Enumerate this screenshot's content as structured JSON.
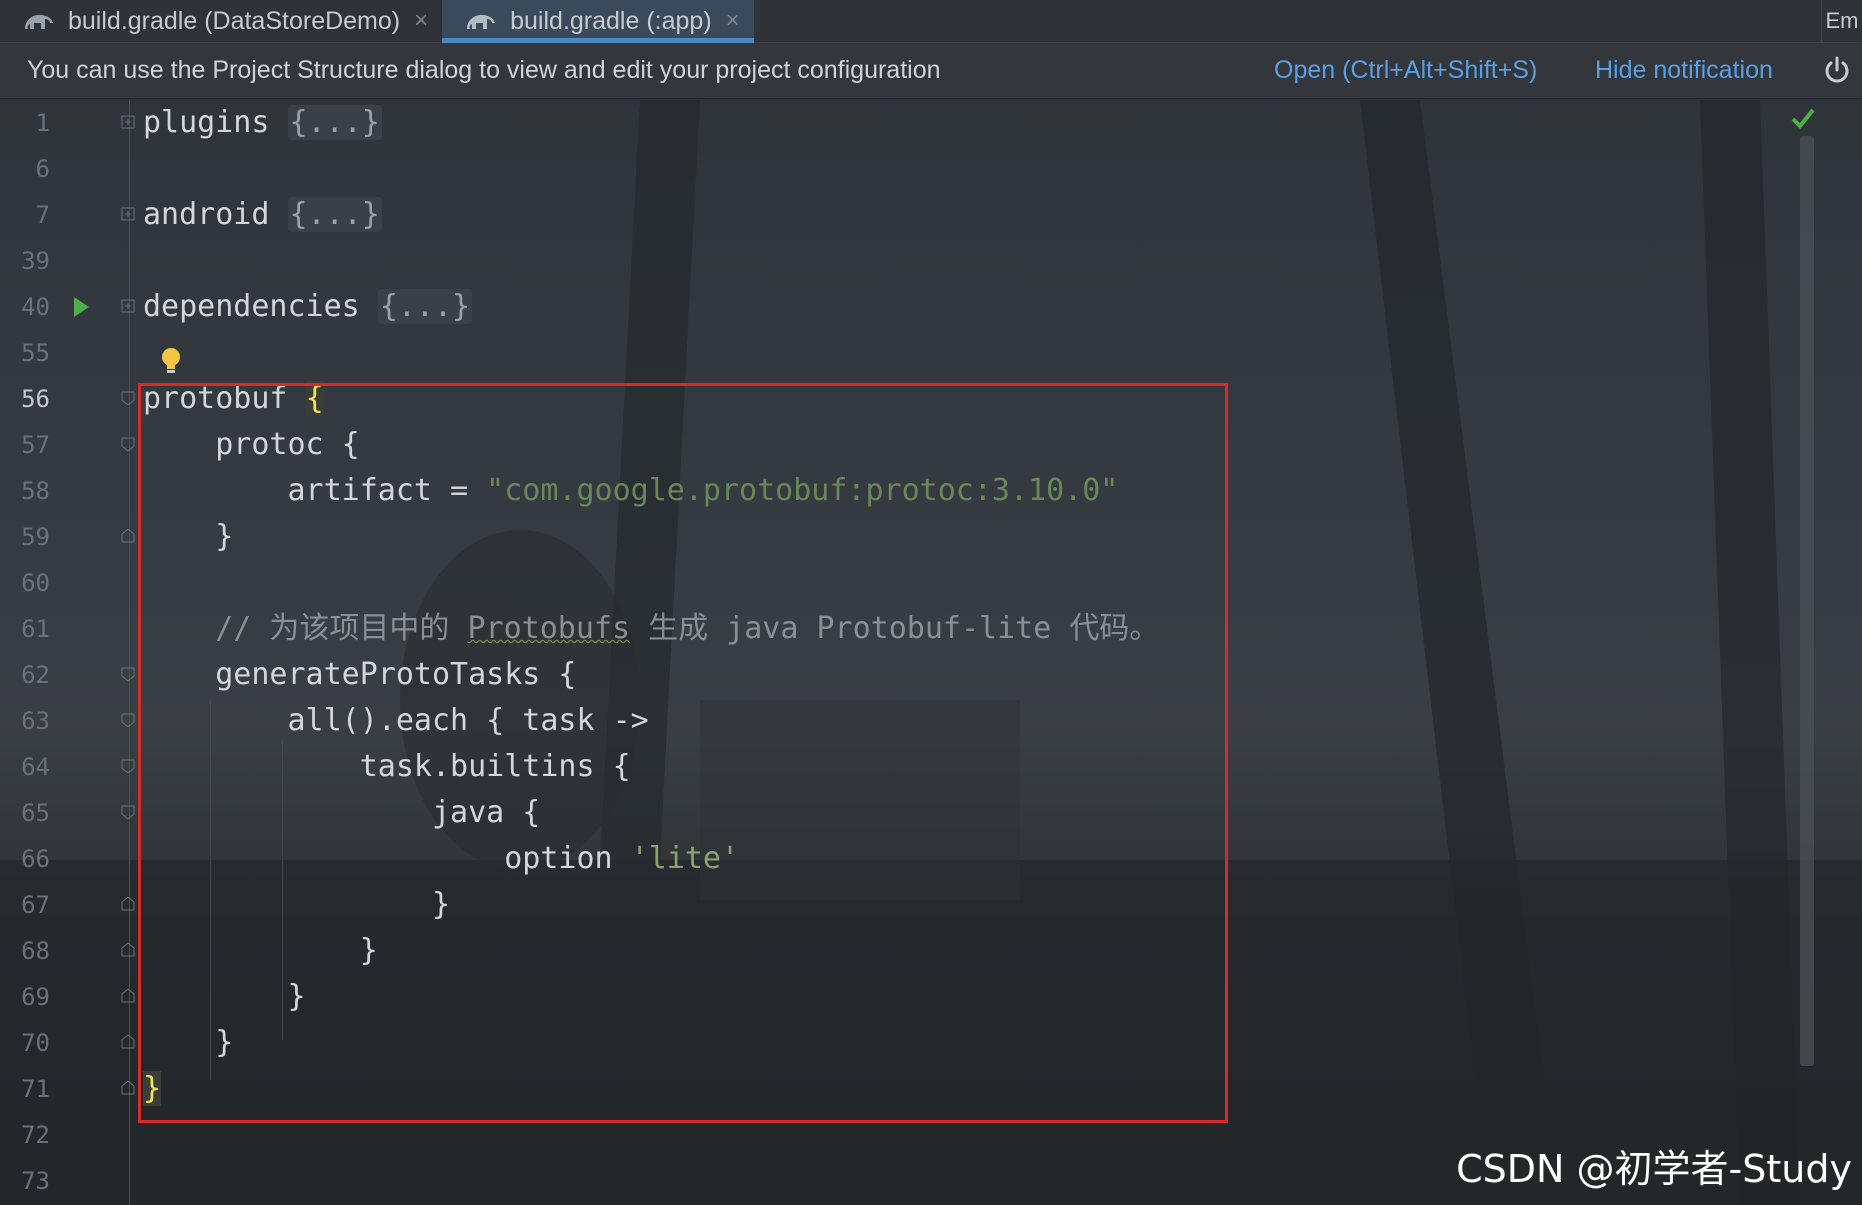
{
  "tabs": [
    {
      "label": "build.gradle (DataStoreDemo)",
      "active": false
    },
    {
      "label": "build.gradle (:app)",
      "active": true
    }
  ],
  "tab_overflow_label": "Em",
  "notification": {
    "message": "You can use the Project Structure dialog to view and edit your project configuration",
    "open_link": "Open (Ctrl+Alt+Shift+S)",
    "hide_link": "Hide notification"
  },
  "editor": {
    "current_line": "56",
    "lines": [
      {
        "n": "1",
        "code": "plugins",
        "folded": "{...}"
      },
      {
        "n": "6",
        "code": ""
      },
      {
        "n": "7",
        "code": "android",
        "folded": "{...}"
      },
      {
        "n": "39",
        "code": ""
      },
      {
        "n": "40",
        "code": "dependencies",
        "folded": "{...}"
      },
      {
        "n": "55",
        "code": ""
      },
      {
        "n": "56",
        "code": "protobuf ",
        "brace": "{"
      },
      {
        "n": "57",
        "code": "    protoc {"
      },
      {
        "n": "58",
        "code": "        artifact = ",
        "string": "\"com.google.protobuf:protoc:3.10.0\""
      },
      {
        "n": "59",
        "code": "    }"
      },
      {
        "n": "60",
        "code": ""
      },
      {
        "n": "61",
        "comment_pre": "    // 为该项目中的 ",
        "comment_squiggle": "Protobufs",
        "comment_post": " 生成 java Protobuf-lite 代码。"
      },
      {
        "n": "62",
        "code": "    generateProtoTasks {"
      },
      {
        "n": "63",
        "code": "        all().each { task ->"
      },
      {
        "n": "64",
        "code": "            task.builtins {"
      },
      {
        "n": "65",
        "code": "                java {"
      },
      {
        "n": "66",
        "code": "                    option ",
        "string2": "'lite'"
      },
      {
        "n": "67",
        "code": "                }"
      },
      {
        "n": "68",
        "code": "            }"
      },
      {
        "n": "69",
        "code": "        }"
      },
      {
        "n": "70",
        "code": "    }"
      },
      {
        "n": "71",
        "brace_close": "}"
      },
      {
        "n": "72",
        "code": ""
      },
      {
        "n": "73",
        "code": ""
      }
    ]
  },
  "watermark": "CSDN @初学者-Study",
  "colors": {
    "accent_link": "#5a9fe6",
    "highlight_box": "#d42b2b",
    "string": "#6a8759",
    "brace_highlight": "#f1e05a"
  }
}
